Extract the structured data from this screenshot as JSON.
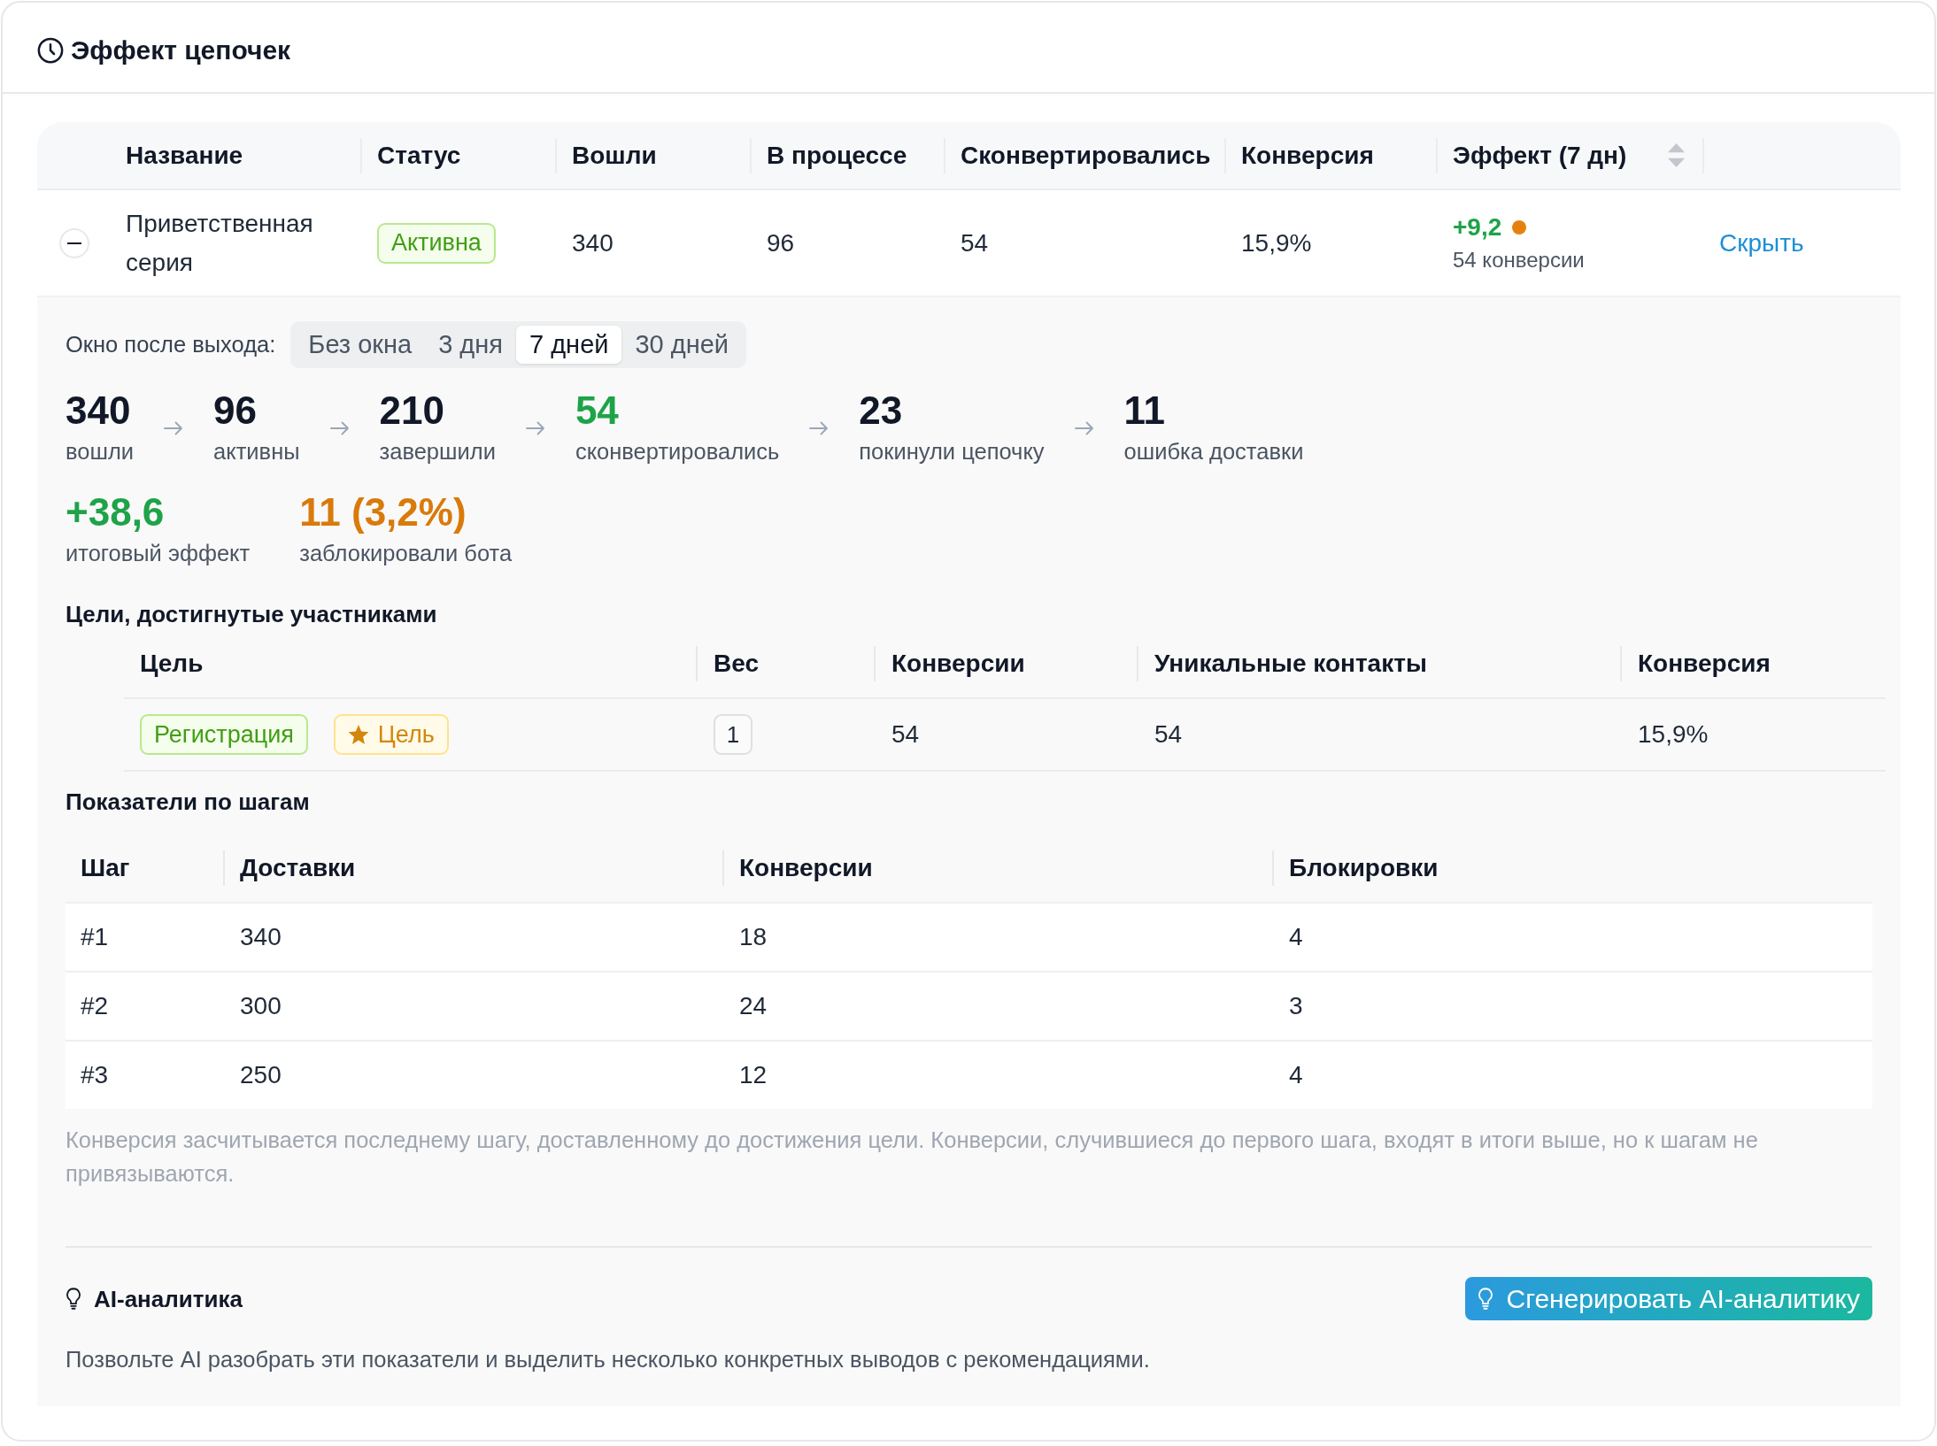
{
  "card": {
    "title": "Эффект цепочек"
  },
  "table": {
    "columns": [
      {
        "label": "Название",
        "sortable": false
      },
      {
        "label": "Статус",
        "sortable": false
      },
      {
        "label": "Вошли",
        "sortable": false
      },
      {
        "label": "В процессе",
        "sortable": false
      },
      {
        "label": "Сконвертировались",
        "sortable": false
      },
      {
        "label": "Конверсия",
        "sortable": false
      },
      {
        "label": "Эффект (7 дн)",
        "sortable": true
      }
    ],
    "rows": [
      {
        "expanded": true,
        "name": "Приветственная серия",
        "status": {
          "label": "Активна",
          "kind": "active"
        },
        "entered": "340",
        "in_progress": "96",
        "converted": "54",
        "conversion": "15,9%",
        "effect": {
          "value": "+9,2",
          "color": "#e5820f",
          "note": "54 конверсии"
        },
        "action": "Скрыть",
        "details": {
          "window_filter": {
            "label": "Окно после выхода:",
            "options": [
              {
                "label": "Без окна",
                "selected": false
              },
              {
                "label": "3 дня",
                "selected": false
              },
              {
                "label": "7 дней",
                "selected": true
              },
              {
                "label": "30 дней",
                "selected": false
              }
            ]
          },
          "funnel": [
            {
              "value": "340",
              "label": "вошли",
              "kind": "neutral"
            },
            {
              "value": "96",
              "label": "активны",
              "kind": "neutral"
            },
            {
              "value": "210",
              "label": "завершили",
              "kind": "neutral"
            },
            {
              "value": "54",
              "label": "сконвертировались",
              "kind": "positive"
            },
            {
              "value": "23",
              "label": "покинули цепочку",
              "kind": "neutral"
            },
            {
              "value": "11",
              "label": "ошибка доставки",
              "kind": "neutral"
            }
          ],
          "totals": [
            {
              "value": "+38,6",
              "label": "итоговый эффект",
              "kind": "positive"
            },
            {
              "value": "11 (3,2%)",
              "label": "заблокировали бота",
              "kind": "warning"
            }
          ],
          "goals": {
            "title": "Цели, достигнутые участниками",
            "columns": [
              "Цель",
              "Вес",
              "Конверсии",
              "Уникальные контакты",
              "Конверсия"
            ],
            "rows": [
              {
                "tags": [
                  {
                    "label": "Регистрация",
                    "kind": "event"
                  },
                  {
                    "label": "Цель",
                    "kind": "goal"
                  }
                ],
                "weight": "1",
                "conversions": "54",
                "unique_contacts": "54",
                "conversion": "15,9%"
              }
            ]
          },
          "steps": {
            "title": "Показатели по шагам",
            "columns": [
              "Шаг",
              "Доставки",
              "Конверсии",
              "Блокировки"
            ],
            "rows": [
              {
                "step": "#1",
                "deliveries": "340",
                "conversions": "18",
                "blocks": "4"
              },
              {
                "step": "#2",
                "deliveries": "300",
                "conversions": "24",
                "blocks": "3"
              },
              {
                "step": "#3",
                "deliveries": "250",
                "conversions": "12",
                "blocks": "4"
              }
            ],
            "note": "Конверсия засчитывается последнему шагу, доставленному до достижения цели. Конверсии, случившиеся до первого шага, входят в итоги выше, но к шагам не привязываются."
          },
          "ai": {
            "title": "AI-аналитика",
            "button": "Сгенерировать AI-аналитику",
            "description": "Позвольте AI разобрать эти показатели и выделить несколько конкретных выводов с рекомендациями."
          }
        }
      }
    ]
  }
}
